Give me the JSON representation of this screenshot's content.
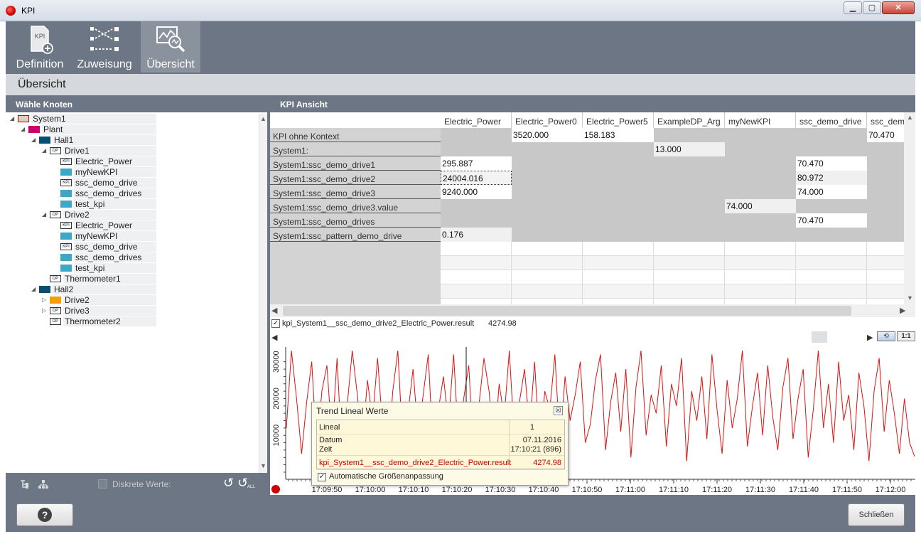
{
  "window": {
    "title": "KPI",
    "min_label": "▁",
    "max_label": "▢",
    "close_label": "✕"
  },
  "toolbar": {
    "definition_label": "Definition",
    "definition_icon_text": "KPI",
    "zuweisung_label": "Zuweisung",
    "uebersicht_label": "Übersicht"
  },
  "section": {
    "title": "Übersicht"
  },
  "tree": {
    "header": "Wähle Knoten",
    "nodes": [
      {
        "label": "System1",
        "level": 0,
        "arrow": "◢",
        "icon": "system-icon",
        "color": "#e8c9c9"
      },
      {
        "label": "Plant",
        "level": 1,
        "arrow": "◢",
        "icon": "plant-icon",
        "color": "#c8006e"
      },
      {
        "label": "Hall1",
        "level": 2,
        "arrow": "◢",
        "icon": "hall-icon",
        "color": "#0b4e73"
      },
      {
        "label": "Drive1",
        "level": 3,
        "arrow": "◢",
        "icon": "dp-icon",
        "color": "#ffffff"
      },
      {
        "label": "Electric_Power",
        "level": 4,
        "arrow": "",
        "icon": "kpi-icon",
        "color": "#ffffff"
      },
      {
        "label": "myNewKPI",
        "level": 4,
        "arrow": "",
        "icon": "kpi-tile-icon",
        "color": "#3da7c7"
      },
      {
        "label": "ssc_demo_drive",
        "level": 4,
        "arrow": "",
        "icon": "kpi-icon",
        "color": "#ffffff"
      },
      {
        "label": "ssc_demo_drives",
        "level": 4,
        "arrow": "",
        "icon": "kpi-tile-icon",
        "color": "#3da7c7"
      },
      {
        "label": "test_kpi",
        "level": 4,
        "arrow": "",
        "icon": "kpi-tile-icon",
        "color": "#3da7c7"
      },
      {
        "label": "Drive2",
        "level": 3,
        "arrow": "◢",
        "icon": "dp-icon",
        "color": "#ffffff"
      },
      {
        "label": "Electric_Power",
        "level": 4,
        "arrow": "",
        "icon": "kpi-icon",
        "color": "#ffffff"
      },
      {
        "label": "myNewKPI",
        "level": 4,
        "arrow": "",
        "icon": "kpi-tile-icon",
        "color": "#3da7c7"
      },
      {
        "label": "ssc_demo_drive",
        "level": 4,
        "arrow": "",
        "icon": "kpi-icon",
        "color": "#ffffff"
      },
      {
        "label": "ssc_demo_drives",
        "level": 4,
        "arrow": "",
        "icon": "kpi-tile-icon",
        "color": "#3da7c7"
      },
      {
        "label": "test_kpi",
        "level": 4,
        "arrow": "",
        "icon": "kpi-tile-icon",
        "color": "#3da7c7"
      },
      {
        "label": "Thermometer1",
        "level": 3,
        "arrow": "",
        "icon": "dp-icon",
        "color": "#ffffff"
      },
      {
        "label": "Hall2",
        "level": 2,
        "arrow": "◢",
        "icon": "hall-icon",
        "color": "#0b4e73"
      },
      {
        "label": "Drive2",
        "level": 3,
        "arrow": "▷",
        "icon": "folder-icon",
        "color": "#f5a000"
      },
      {
        "label": "Drive3",
        "level": 3,
        "arrow": "▷",
        "icon": "dp-icon",
        "color": "#ffffff"
      },
      {
        "label": "Thermometer2",
        "level": 3,
        "arrow": "",
        "icon": "dp-icon",
        "color": "#ffffff"
      }
    ],
    "discrete_label": "Diskrete Werte:",
    "reset_all_label": "ALL"
  },
  "kpi_view": {
    "header": "KPI Ansicht",
    "columns": [
      "Electric_Power",
      "Electric_Power0",
      "Electric_Power5",
      "ExampleDP_Arg",
      "myNewKPI",
      "ssc_demo_drive",
      "ssc_dem"
    ],
    "rows": [
      {
        "label": "KPI ohne Kontext",
        "cells": [
          "",
          "3520.000",
          "158.183",
          "",
          "",
          "",
          "70.470"
        ]
      },
      {
        "label": "System1:",
        "cells": [
          "",
          "",
          "",
          "13.000",
          "",
          "",
          ""
        ]
      },
      {
        "label": "System1:ssc_demo_drive1",
        "cells": [
          "295.887",
          "",
          "",
          "",
          "",
          "70.470",
          ""
        ]
      },
      {
        "label": "System1:ssc_demo_drive2",
        "cells": [
          "24004.016",
          "",
          "",
          "",
          "",
          "80.972",
          ""
        ]
      },
      {
        "label": "System1:ssc_demo_drive3",
        "cells": [
          "9240.000",
          "",
          "",
          "",
          "",
          "74.000",
          ""
        ]
      },
      {
        "label": "System1:ssc_demo_drive3.value",
        "cells": [
          "",
          "",
          "",
          "",
          "74.000",
          "",
          ""
        ]
      },
      {
        "label": "System1:ssc_demo_drives",
        "cells": [
          "",
          "",
          "",
          "",
          "",
          "70.470",
          ""
        ]
      },
      {
        "label": "System1:ssc_pattern_demo_drive",
        "cells": [
          "0.176",
          "",
          "",
          "",
          "",
          "",
          ""
        ]
      }
    ]
  },
  "trend": {
    "series_name": "kpi_System1__ssc_demo_drive2_Electric_Power.result",
    "series_value": "4274.98",
    "series_color": "#e01010",
    "one_to_one_label": "1:1",
    "popup": {
      "title": "Trend Lineal Werte",
      "close_label": "☒",
      "lineal_label": "Lineal",
      "lineal_value": "1",
      "datum_label": "Datum",
      "zeit_label": "Zeit",
      "datum_value": "07.11.2016",
      "zeit_value": "17:10:21 (896)",
      "series_label": "kpi_System1__ssc_demo_drive2_Electric_Power.result",
      "series_value": "4274.98",
      "auto_size_label": "Automatische Größenanpassung"
    }
  },
  "chart_data": {
    "type": "line",
    "title": "",
    "xlabel": "",
    "ylabel": "",
    "y_ticks": [
      "10000",
      "20000",
      "30000"
    ],
    "x_ticks": [
      "17:09:50",
      "17:10:00",
      "17:10:10",
      "17:10:20",
      "17:10:30",
      "17:10:40",
      "17:10:50",
      "17:11:00",
      "17:11:10",
      "17:11:20",
      "17:11:30",
      "17:11:40",
      "17:11:50",
      "17:12:00"
    ],
    "ylim": [
      0,
      34000
    ],
    "grid": false,
    "series": [
      {
        "name": "kpi_System1__ssc_demo_drive2_Electric_Power.result",
        "values": [
          12000,
          33000,
          20000,
          5000,
          19000,
          30000,
          6000,
          22000,
          29000,
          9000,
          31000,
          4000,
          18000,
          33000,
          21000,
          8000,
          25000,
          14000,
          31000,
          12000,
          3000,
          22000,
          33000,
          7000,
          16000,
          28000,
          10000,
          21000,
          32000,
          5000,
          17000,
          26000,
          13000,
          32000,
          8000,
          20000,
          29000,
          4000,
          18000,
          31000,
          22000,
          6000,
          24000,
          15000,
          33000,
          9000,
          19000,
          28000,
          12000,
          30000,
          5000,
          22000,
          17000,
          32000,
          7000,
          26000,
          14000,
          21000,
          30000,
          8000,
          13000,
          25000,
          32000,
          6000,
          19000,
          27000,
          11000,
          28000,
          4000,
          23000,
          33000,
          10000,
          21000,
          16000,
          29000,
          7000,
          24000,
          18000,
          31000,
          3000,
          22000,
          14000,
          26000,
          9000,
          32000,
          17000,
          5000,
          25000,
          12000,
          20000,
          33000,
          7000,
          18000,
          27000,
          10000,
          29000,
          15000,
          6000,
          23000,
          31000,
          9000,
          20000,
          28000,
          4000,
          17000,
          33000,
          12000,
          24000,
          8000,
          30000,
          14000,
          21000,
          6000,
          27000,
          18000,
          3000,
          22000,
          31000,
          11000,
          25000,
          16000,
          5000,
          20000,
          8000,
          4274
        ]
      }
    ]
  },
  "footer": {
    "help_label": "?",
    "close_label": "Schließen"
  }
}
